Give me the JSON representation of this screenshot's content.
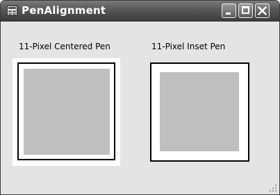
{
  "window": {
    "title": "PenAlignment",
    "controls": [
      "minimize",
      "maximize",
      "close"
    ]
  },
  "panels": {
    "centered": {
      "label": "11-Pixel Centered Pen"
    },
    "inset": {
      "label": "11-Pixel Inset Pen"
    }
  },
  "icons": {
    "app": "app-window-icon",
    "minimize": "minimize-icon",
    "maximize": "maximize-icon",
    "close": "close-icon",
    "resize": "resize-grip-icon"
  },
  "colors": {
    "fill": "#bfbfbf",
    "pen": "#000000",
    "client_background": "#e4e4e4"
  }
}
